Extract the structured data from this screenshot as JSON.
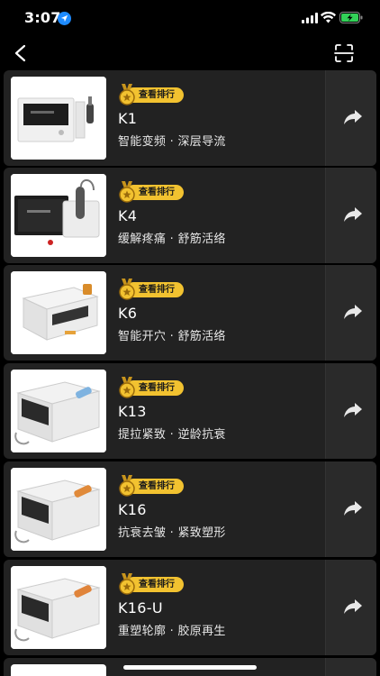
{
  "status_bar": {
    "time": "3:07"
  },
  "nav": {},
  "products": [
    {
      "model": "K1",
      "rank_label": "查看排行",
      "features": "智能变频 · 深层导流"
    },
    {
      "model": "K4",
      "rank_label": "查看排行",
      "features": "缓解疼痛 · 舒筋活络"
    },
    {
      "model": "K6",
      "rank_label": "查看排行",
      "features": "智能开穴 · 舒筋活络"
    },
    {
      "model": "K13",
      "rank_label": "查看排行",
      "features": "提拉紧致 · 逆龄抗衰"
    },
    {
      "model": "K16",
      "rank_label": "查看排行",
      "features": "抗衰去皱 · 紧致塑形"
    },
    {
      "model": "K16-U",
      "rank_label": "查看排行",
      "features": "重塑轮廓 · 胶原再生"
    }
  ],
  "colors": {
    "background": "#000000",
    "card": "#222222",
    "badge": "#f2c230",
    "location": "#1e8bff",
    "battery": "#33d158"
  }
}
